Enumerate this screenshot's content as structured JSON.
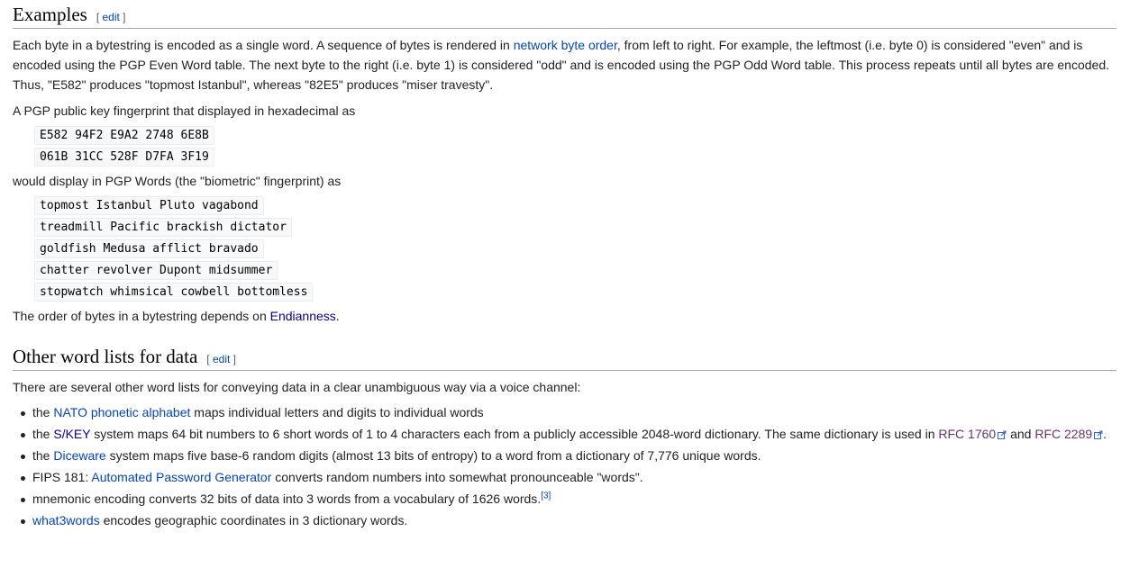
{
  "section1": {
    "title": "Examples",
    "edit_label": "edit",
    "para1": {
      "before": "Each byte in a bytestring is encoded as a single word. A sequence of bytes is rendered in ",
      "link": "network byte order",
      "after": ", from left to right. For example, the leftmost (i.e. byte 0) is considered \"even\" and is encoded using the PGP Even Word table. The next byte to the right (i.e. byte 1) is considered \"odd\" and is encoded using the PGP Odd Word table. This process repeats until all bytes are encoded. Thus, \"E582\" produces \"topmost Istanbul\", whereas \"82E5\" produces \"miser travesty\"."
    },
    "para2": "A PGP public key fingerprint that displayed in hexadecimal as",
    "hex_lines": [
      "E582 94F2 E9A2 2748 6E8B",
      "061B 31CC 528F D7FA 3F19"
    ],
    "para3": "would display in PGP Words (the \"biometric\" fingerprint) as",
    "word_lines": [
      "topmost Istanbul Pluto vagabond",
      "treadmill Pacific brackish dictator",
      "goldfish Medusa afflict bravado",
      "chatter revolver Dupont midsummer",
      "stopwatch whimsical cowbell bottomless"
    ],
    "para4": {
      "before": "The order of bytes in a bytestring depends on ",
      "link": "Endianness",
      "after": "."
    }
  },
  "section2": {
    "title": "Other word lists for data",
    "edit_label": "edit",
    "intro": "There are several other word lists for conveying data in a clear unambiguous way via a voice channel:",
    "items": {
      "i1": {
        "pre": "the ",
        "link": "NATO phonetic alphabet",
        "post": " maps individual letters and digits to individual words"
      },
      "i2": {
        "pre": "the ",
        "link": "S/KEY",
        "mid": " system maps 64 bit numbers to 6 short words of 1 to 4 characters each from a publicly accessible 2048-word dictionary. The same dictionary is used in ",
        "rfc1": "RFC 1760",
        "and": " and ",
        "rfc2": "RFC 2289",
        "post": "."
      },
      "i3": {
        "pre": "the ",
        "link": "Diceware",
        "post": " system maps five base-6 random digits (almost 13 bits of entropy) to a word from a dictionary of 7,776 unique words."
      },
      "i4": {
        "pre": "FIPS 181: ",
        "link": "Automated Password Generator",
        "post": " converts random numbers into somewhat pronounceable \"words\"."
      },
      "i5": {
        "text": "mnemonic encoding converts 32 bits of data into 3 words from a vocabulary of 1626 words.",
        "ref": "[3]"
      },
      "i6": {
        "link": "what3words",
        "post": " encodes geographic coordinates in 3 dictionary words."
      }
    }
  },
  "colors": {
    "link": "#0645ad",
    "visited_link": "#0b0080",
    "external_visited": "#663366",
    "text": "#222222",
    "code_bg": "#f8f9fa",
    "rule": "#a2a9b1"
  },
  "icons": {
    "external_link": "external-link-icon",
    "bullet": "bullet-icon"
  }
}
